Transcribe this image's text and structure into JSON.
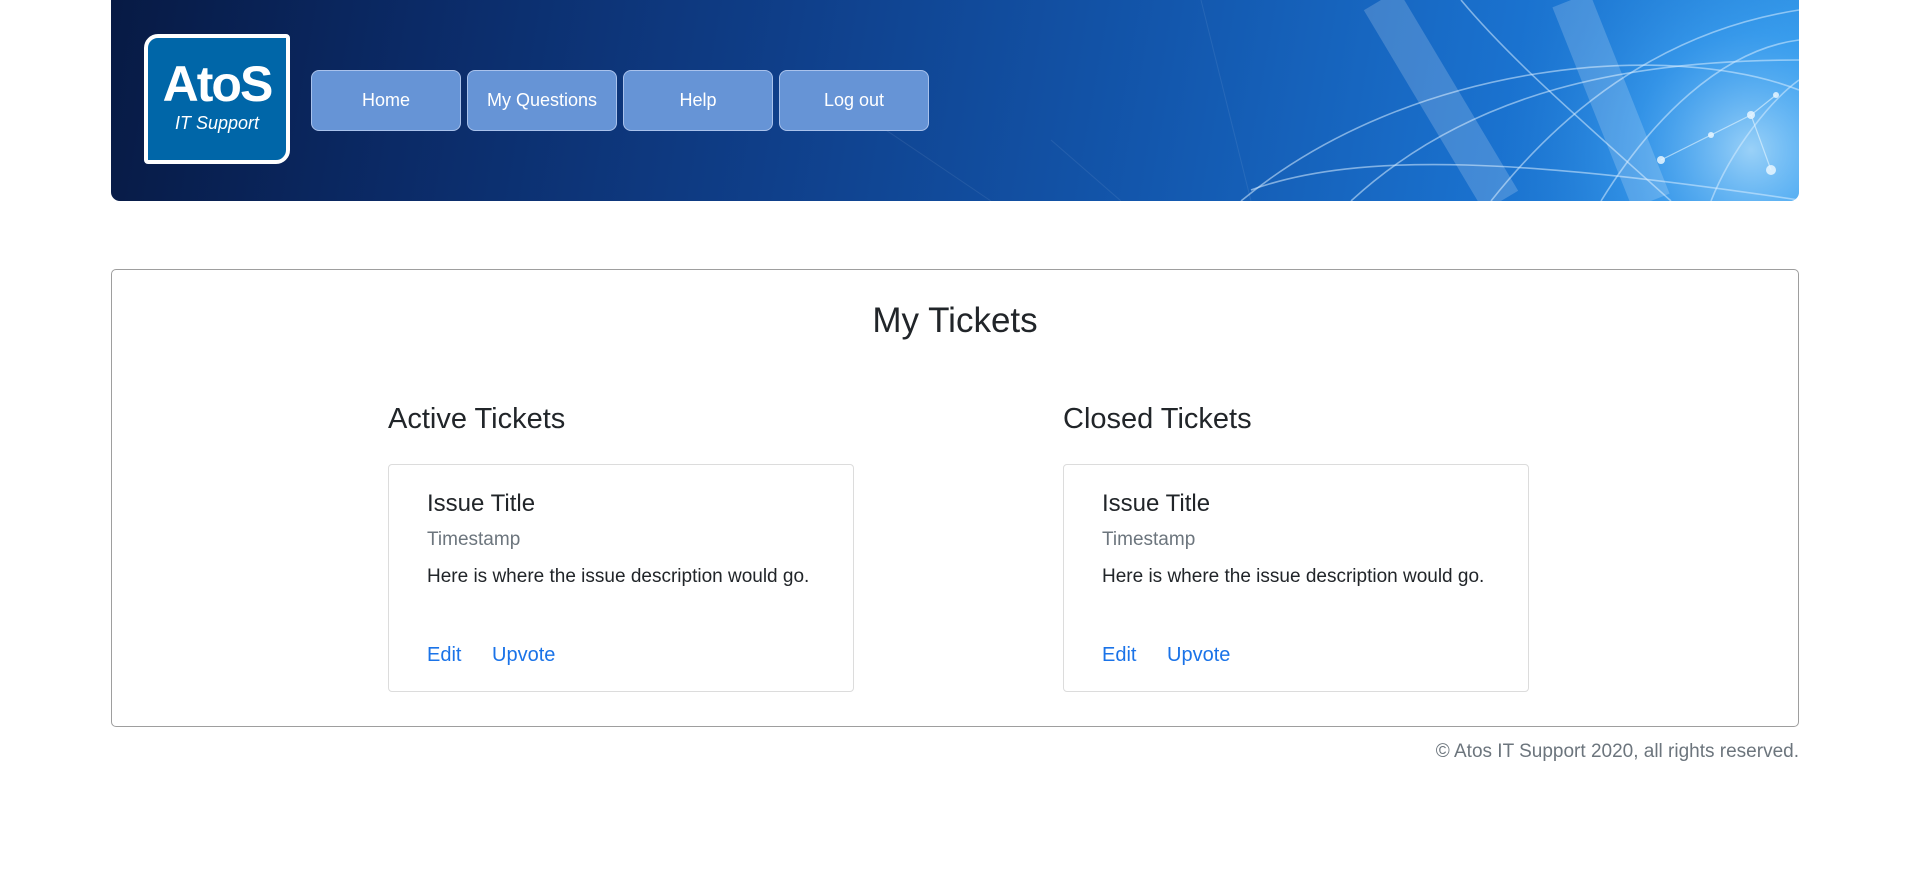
{
  "header": {
    "logo": {
      "main": "AtoS",
      "sub": "IT Support"
    },
    "nav": [
      {
        "label": "Home"
      },
      {
        "label": "My Questions"
      },
      {
        "label": "Help"
      },
      {
        "label": "Log out"
      }
    ],
    "colors": {
      "banner_dark": "#071a44",
      "banner_light": "#2f95e6",
      "nav_button": "#6694d6"
    }
  },
  "main": {
    "title": "My Tickets",
    "active": {
      "heading": "Active Tickets",
      "ticket": {
        "title": "Issue Title",
        "timestamp": "Timestamp",
        "description": "Here is where the issue description would go.",
        "edit_label": "Edit",
        "upvote_label": "Upvote"
      }
    },
    "closed": {
      "heading": "Closed Tickets",
      "ticket": {
        "title": "Issue Title",
        "timestamp": "Timestamp",
        "description": "Here is where the issue description would go.",
        "edit_label": "Edit",
        "upvote_label": "Upvote"
      }
    },
    "colors": {
      "link": "#1a73e8",
      "muted": "#6c757d"
    }
  },
  "footer": {
    "copyright": "© Atos IT Support 2020, all rights reserved."
  }
}
